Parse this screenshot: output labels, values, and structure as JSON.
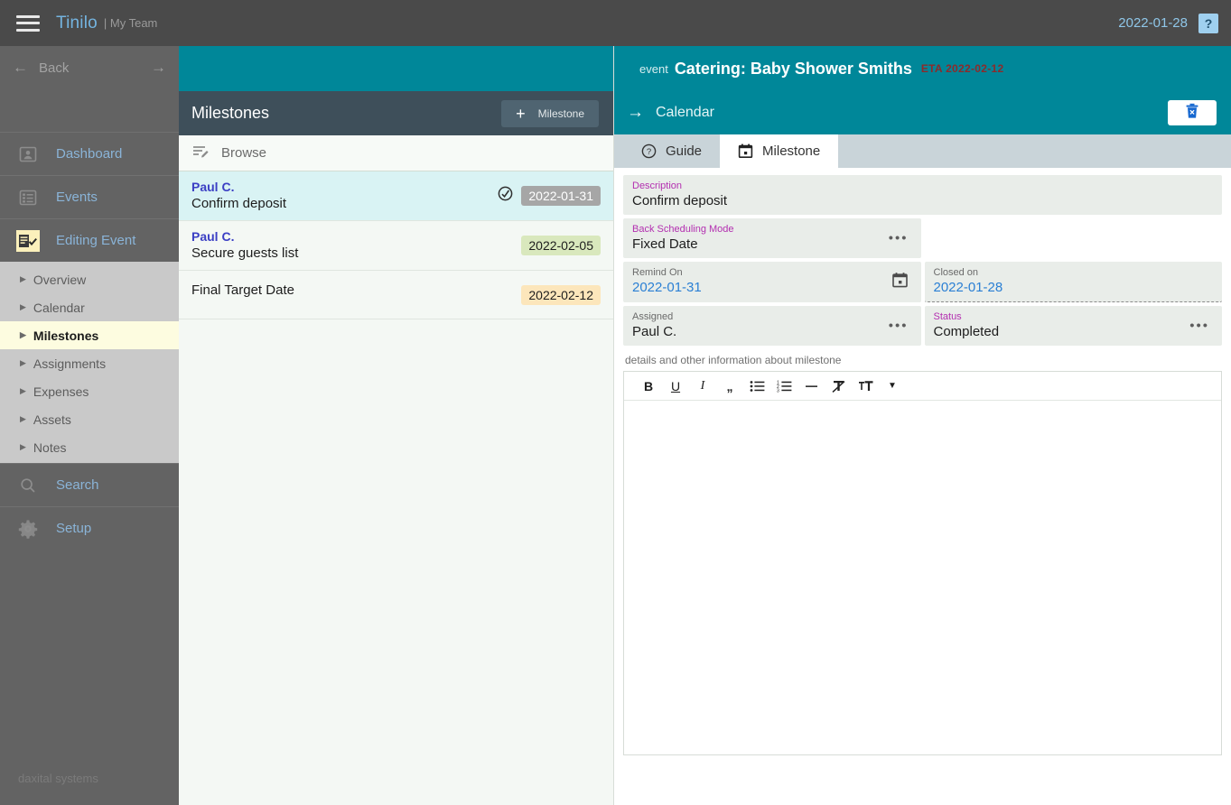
{
  "topbar": {
    "menu_icon": "hamburger-icon",
    "brand": "Tinilo",
    "brand_sub": "| My Team",
    "date": "2022-01-28",
    "help": "?"
  },
  "sidebar": {
    "back_label": "Back",
    "main_items": [
      {
        "label": "Dashboard",
        "icon": "contact-card-icon"
      },
      {
        "label": "Events",
        "icon": "list-grid-icon"
      },
      {
        "label": "Editing Event",
        "icon": "edit-checklist-icon"
      }
    ],
    "sub_items": [
      {
        "label": "Overview"
      },
      {
        "label": "Calendar"
      },
      {
        "label": "Milestones"
      },
      {
        "label": "Assignments"
      },
      {
        "label": "Expenses"
      },
      {
        "label": "Assets"
      },
      {
        "label": "Notes"
      }
    ],
    "selected_sub": "Milestones",
    "bottom_items": [
      {
        "label": "Search",
        "icon": "magnifier-icon"
      },
      {
        "label": "Setup",
        "icon": "gear-icon"
      }
    ],
    "footer": "daxital systems"
  },
  "list_panel": {
    "title": "Milestones",
    "add_button": {
      "plus": "+",
      "label": "Milestone"
    },
    "browse_label": "Browse",
    "rows": [
      {
        "who": "Paul C.",
        "description": "Confirm deposit",
        "date": "2022-01-31",
        "badge_style": "gray",
        "completed": true,
        "selected": true
      },
      {
        "who": "Paul C.",
        "description": "Secure guests list",
        "date": "2022-02-05",
        "badge_style": "green",
        "completed": false,
        "selected": false
      },
      {
        "who": "",
        "description": "Final Target Date",
        "date": "2022-02-12",
        "badge_style": "amber",
        "completed": false,
        "selected": false
      }
    ]
  },
  "detail": {
    "event_kind": "event",
    "event_name": "Catering: Baby Shower Smiths",
    "event_eta": "ETA 2022-02-12",
    "nav_label": "Calendar",
    "delete_icon": "trash-delete-icon",
    "tabs": [
      {
        "label": "Guide",
        "icon": "question-circle-icon",
        "active": false
      },
      {
        "label": "Milestone",
        "icon": "calendar-icon",
        "active": true
      }
    ],
    "fields": {
      "description": {
        "label": "Description",
        "value": "Confirm deposit"
      },
      "back_scheduling_mode": {
        "label": "Back Scheduling Mode",
        "value": "Fixed Date"
      },
      "remind_on": {
        "label": "Remind On",
        "value": "2022-01-31"
      },
      "closed_on": {
        "label": "Closed on",
        "value": "2022-01-28"
      },
      "assigned": {
        "label": "Assigned",
        "value": "Paul C."
      },
      "status": {
        "label": "Status",
        "value": "Completed"
      }
    },
    "notes_hint": "details and other information about milestone",
    "toolbar": [
      {
        "name": "bold",
        "glyph": "B"
      },
      {
        "name": "underline",
        "glyph": "U"
      },
      {
        "name": "italic",
        "glyph": "I"
      },
      {
        "name": "quote",
        "glyph": "”"
      },
      {
        "name": "bullet-list",
        "glyph": "☰"
      },
      {
        "name": "numbered-list",
        "glyph": "☰"
      },
      {
        "name": "horizontal-rule",
        "glyph": "–"
      },
      {
        "name": "clear-format",
        "glyph": "T̶"
      },
      {
        "name": "font-size",
        "glyph": "T"
      },
      {
        "name": "font-size-caret",
        "glyph": "▾"
      }
    ],
    "editor_content": ""
  },
  "colors": {
    "teal": "#008799",
    "slate": "#3e4f5a",
    "sidebar": "#636363",
    "accent_link": "#3b3fc4",
    "label_pink": "#b32fb0"
  }
}
